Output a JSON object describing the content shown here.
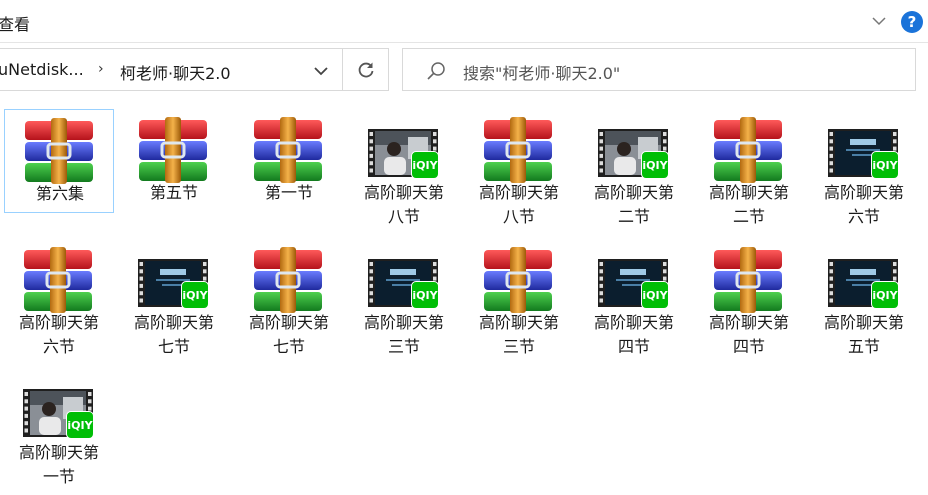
{
  "ribbon": {
    "tab_label": "查看"
  },
  "address": {
    "crumb_parent": "uNetdisk...",
    "separator": "›",
    "crumb_current": "柯老师·聊天2.0"
  },
  "search": {
    "placeholder": "搜索\"柯老师·聊天2.0\""
  },
  "help_label": "?",
  "items": [
    {
      "label1": "第六集",
      "label2": "",
      "kind": "archive",
      "selected": true
    },
    {
      "label1": "第五节",
      "label2": "",
      "kind": "archive"
    },
    {
      "label1": "第一节",
      "label2": "",
      "kind": "archive"
    },
    {
      "label1": "高阶聊天第",
      "label2": "八节",
      "kind": "video-person"
    },
    {
      "label1": "高阶聊天第",
      "label2": "八节",
      "kind": "archive"
    },
    {
      "label1": "高阶聊天第",
      "label2": "二节",
      "kind": "video-person"
    },
    {
      "label1": "高阶聊天第",
      "label2": "二节",
      "kind": "archive"
    },
    {
      "label1": "高阶聊天第",
      "label2": "六节",
      "kind": "video-title"
    },
    {
      "label1": "高阶聊天第",
      "label2": "六节",
      "kind": "archive"
    },
    {
      "label1": "高阶聊天第",
      "label2": "七节",
      "kind": "video-title"
    },
    {
      "label1": "高阶聊天第",
      "label2": "七节",
      "kind": "archive"
    },
    {
      "label1": "高阶聊天第",
      "label2": "三节",
      "kind": "video-title"
    },
    {
      "label1": "高阶聊天第",
      "label2": "三节",
      "kind": "archive"
    },
    {
      "label1": "高阶聊天第",
      "label2": "四节",
      "kind": "video-title"
    },
    {
      "label1": "高阶聊天第",
      "label2": "四节",
      "kind": "archive"
    },
    {
      "label1": "高阶聊天第",
      "label2": "五节",
      "kind": "video-title"
    },
    {
      "label1": "高阶聊天第",
      "label2": "一节",
      "kind": "video-person"
    }
  ],
  "video_badge": "iQIY",
  "colors": {
    "accent": "#1a73d9",
    "iqiyi_green": "#00be06",
    "selection_border": "#99d1ff"
  }
}
